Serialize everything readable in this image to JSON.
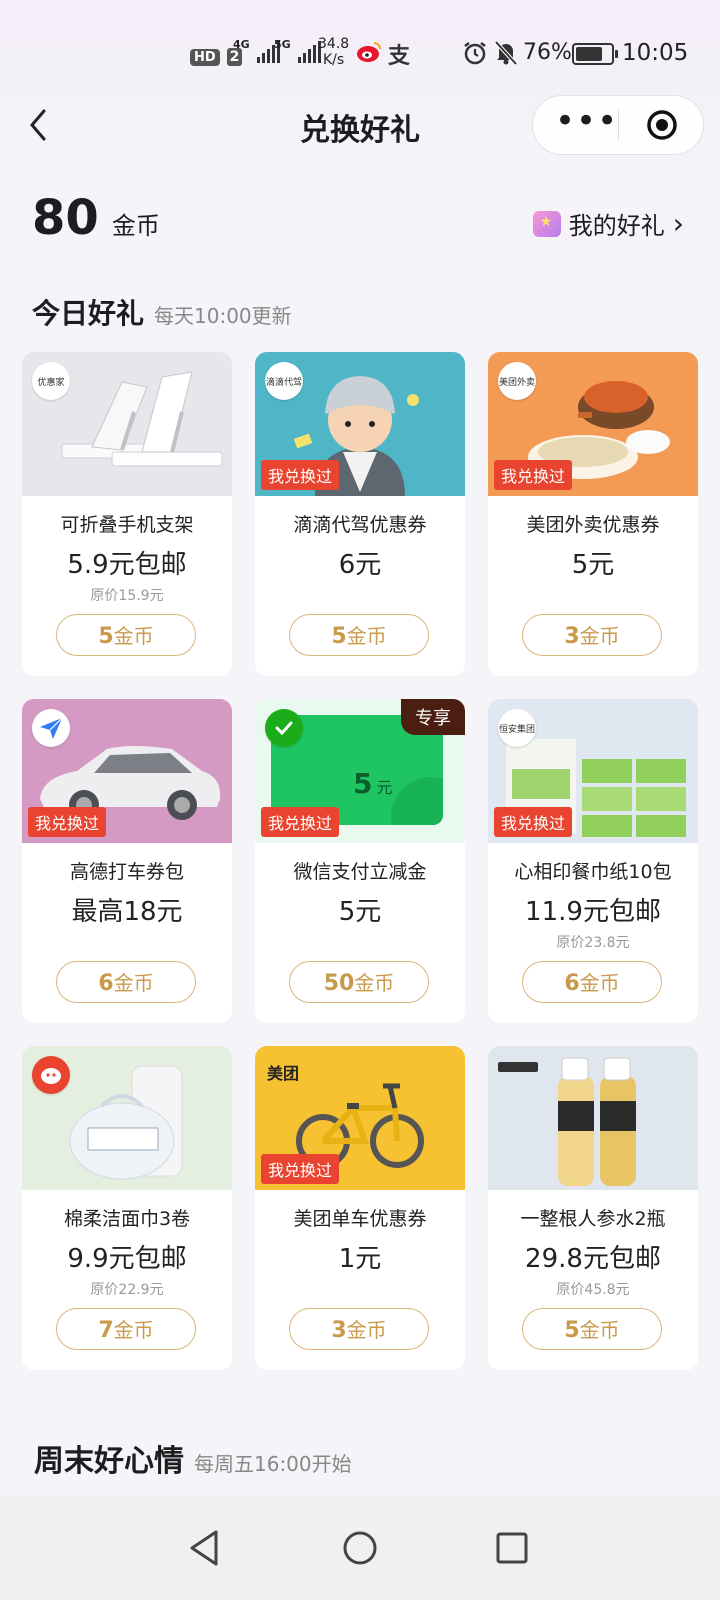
{
  "status_bar": {
    "hd": "HD",
    "sim": "2",
    "net1": "4G",
    "net2": "5G",
    "speed_value": "34.8",
    "speed_unit": "K/s",
    "battery": "76%",
    "time": "10:05"
  },
  "nav": {
    "title": "兑换好礼",
    "more_label": "•••"
  },
  "balance": {
    "amount": "80",
    "unit": "金币",
    "my_gifts": "我的好礼",
    "chevron": "›"
  },
  "section_today": {
    "title": "今日好礼",
    "subtitle": "每天10:00更新"
  },
  "section_weekend": {
    "title": "周末好心情",
    "subtitle": "每周五16:00开始"
  },
  "cards": [
    {
      "name": "可折叠手机支架",
      "price": "5.9元包邮",
      "original": "原价15.9元",
      "coins": "5",
      "coin_unit": "金币",
      "exchanged": "",
      "exclusive": "",
      "brand": "优惠家",
      "img_bg": "#e7e7ec"
    },
    {
      "name": "滴滴代驾优惠券",
      "price": "6元",
      "original": "",
      "coins": "5",
      "coin_unit": "金币",
      "exchanged": "我兑换过",
      "exclusive": "",
      "brand": "滴滴代驾",
      "img_bg": "#4fb6c8"
    },
    {
      "name": "美团外卖优惠券",
      "price": "5元",
      "original": "",
      "coins": "3",
      "coin_unit": "金币",
      "exchanged": "我兑换过",
      "exclusive": "",
      "brand": "美团外卖",
      "img_bg": "#f39a55"
    },
    {
      "name": "高德打车券包",
      "price": "最高18元",
      "original": "",
      "coins": "6",
      "coin_unit": "金币",
      "exchanged": "我兑换过",
      "exclusive": "",
      "brand": "",
      "img_bg": "#d59ac4"
    },
    {
      "name": "微信支付立减金",
      "price": "5元",
      "original": "",
      "coins": "50",
      "coin_unit": "金币",
      "exchanged": "我兑换过",
      "exclusive": "专享",
      "brand": "",
      "img_bg": "#e9f9f0",
      "coupon_value": "5",
      "coupon_unit": "元"
    },
    {
      "name": "心相印餐巾纸10包",
      "price": "11.9元包邮",
      "original": "原价23.8元",
      "coins": "6",
      "coin_unit": "金币",
      "exchanged": "我兑换过",
      "exclusive": "",
      "brand": "恒安集团",
      "img_bg": "#dfe8f0"
    },
    {
      "name": "棉柔洁面巾3卷",
      "price": "9.9元包邮",
      "original": "原价22.9元",
      "coins": "7",
      "coin_unit": "金币",
      "exchanged": "",
      "exclusive": "",
      "brand": "",
      "img_bg": "#e4efdf"
    },
    {
      "name": "美团单车优惠券",
      "price": "1元",
      "original": "",
      "coins": "3",
      "coin_unit": "金币",
      "exchanged": "我兑换过",
      "exclusive": "",
      "brand": "美团",
      "img_bg": "#f7c232"
    },
    {
      "name": "一整根人参水2瓶",
      "price": "29.8元包邮",
      "original": "原价45.8元",
      "coins": "5",
      "coin_unit": "金币",
      "exchanged": "",
      "exclusive": "",
      "brand": "",
      "img_bg": "#dfe6ee"
    }
  ],
  "colors": {
    "tag_red": "#e8442f",
    "coin_gold": "#c99a4c",
    "exclusive_brown": "#4a1f12"
  }
}
